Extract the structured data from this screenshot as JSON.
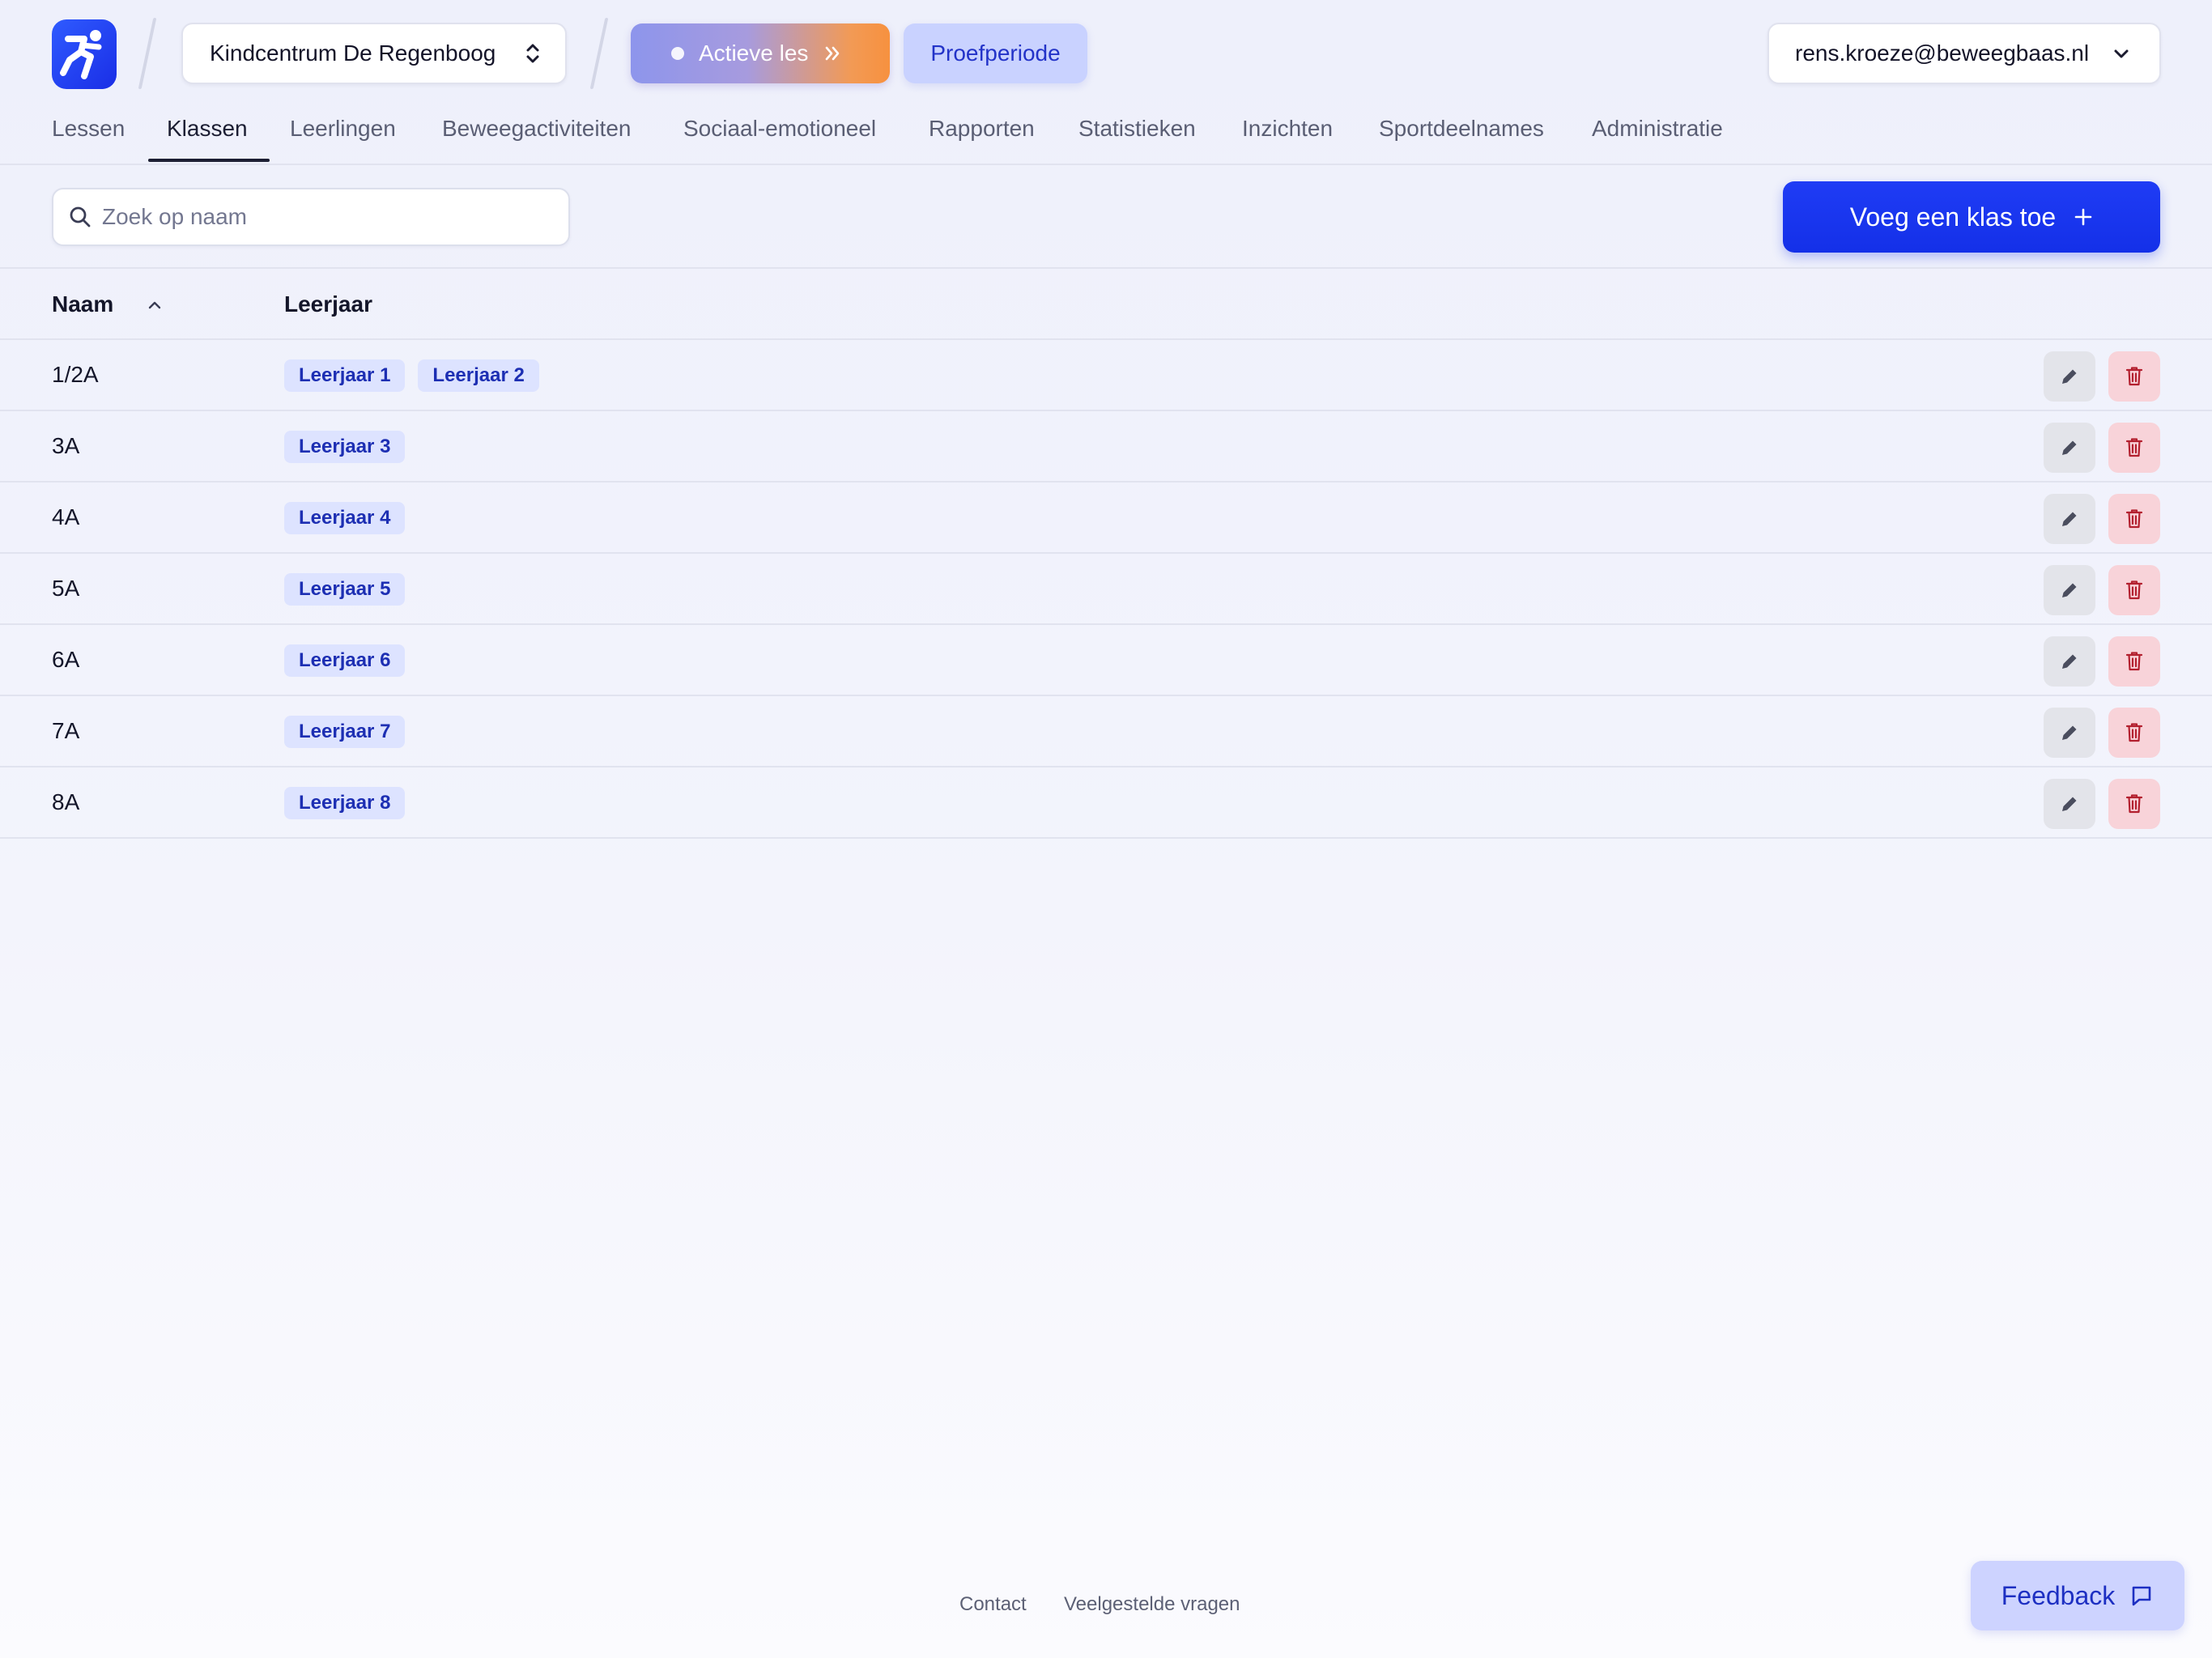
{
  "header": {
    "organization": "Kindcentrum De Regenboog",
    "active_lesson_label": "Actieve les",
    "trial_label": "Proefperiode",
    "user_email": "rens.kroeze@beweegbaas.nl"
  },
  "nav": {
    "items": [
      {
        "label": "Lessen"
      },
      {
        "label": "Klassen"
      },
      {
        "label": "Leerlingen"
      },
      {
        "label": "Beweegactiviteiten"
      },
      {
        "label": "Sociaal-emotioneel"
      },
      {
        "label": "Rapporten"
      },
      {
        "label": "Statistieken"
      },
      {
        "label": "Inzichten"
      },
      {
        "label": "Sportdeelnames"
      },
      {
        "label": "Administratie"
      }
    ],
    "active": "Klassen"
  },
  "toolbar": {
    "search_placeholder": "Zoek op naam",
    "search_value": "",
    "add_button_label": "Voeg een klas toe",
    "add_button_icon": "+"
  },
  "table": {
    "columns": [
      "Naam",
      "Leerjaar"
    ],
    "sort": {
      "column": "Naam",
      "direction": "ascending"
    },
    "rows": [
      {
        "name": "1/2A",
        "grades": [
          "Leerjaar 1",
          "Leerjaar 2"
        ]
      },
      {
        "name": "3A",
        "grades": [
          "Leerjaar 3"
        ]
      },
      {
        "name": "4A",
        "grades": [
          "Leerjaar 4"
        ]
      },
      {
        "name": "5A",
        "grades": [
          "Leerjaar 5"
        ]
      },
      {
        "name": "6A",
        "grades": [
          "Leerjaar 6"
        ]
      },
      {
        "name": "7A",
        "grades": [
          "Leerjaar 7"
        ]
      },
      {
        "name": "8A",
        "grades": [
          "Leerjaar 8"
        ]
      }
    ]
  },
  "footer": {
    "links": [
      "Contact",
      "Veelgestelde vragen"
    ],
    "feedback_label": "Feedback"
  },
  "colors": {
    "brand_blue": "#1f3cf5",
    "badge_bg": "#dde3ff",
    "badge_text": "#1d2fb3",
    "delete_bg": "#f8d3d9",
    "delete_icon": "#b3202f"
  },
  "icons": {
    "logo": "runner-logo-icon",
    "org_select": "chevron-up-down-icon",
    "active_lesson": "double-chevron-right-icon",
    "user_menu": "chevron-down-icon",
    "search": "search-icon",
    "sort": "chevron-up-icon",
    "edit": "pencil-icon",
    "delete": "trash-icon",
    "feedback": "chat-bubble-icon"
  }
}
